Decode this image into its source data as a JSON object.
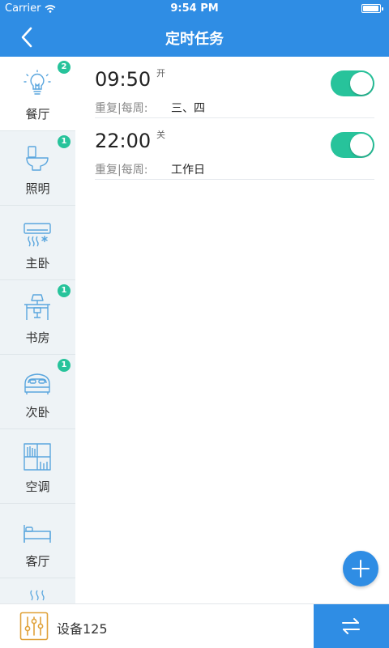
{
  "status_bar": {
    "carrier": "Carrier",
    "time": "9:54 PM"
  },
  "navbar": {
    "title": "定时任务"
  },
  "sidebar": {
    "items": [
      {
        "label": "餐厅",
        "badge": "2",
        "icon": "light-bulb-icon",
        "active": true
      },
      {
        "label": "照明",
        "badge": "1",
        "icon": "toilet-icon"
      },
      {
        "label": "主卧",
        "badge": "",
        "icon": "air-conditioner-icon"
      },
      {
        "label": "书房",
        "badge": "1",
        "icon": "desk-lamp-icon"
      },
      {
        "label": "次卧",
        "badge": "1",
        "icon": "car-bed-icon"
      },
      {
        "label": "空调",
        "badge": "",
        "icon": "bookshelf-icon"
      },
      {
        "label": "客厅",
        "badge": "",
        "icon": "bed-icon"
      }
    ]
  },
  "tasks": [
    {
      "time": "09:50",
      "state": "开",
      "repeat_label": "重复|每周:",
      "days": "三、四",
      "enabled": true
    },
    {
      "time": "22:00",
      "state": "关",
      "repeat_label": "重复|每周:",
      "days": "工作日",
      "enabled": true
    }
  ],
  "bottom": {
    "device_label": "设备125"
  },
  "colors": {
    "primary": "#2f8de4",
    "toggle_on": "#27c39b",
    "badge": "#27c39b",
    "sidebar_bg": "#eef3f6",
    "device_icon": "#e0a23a"
  }
}
